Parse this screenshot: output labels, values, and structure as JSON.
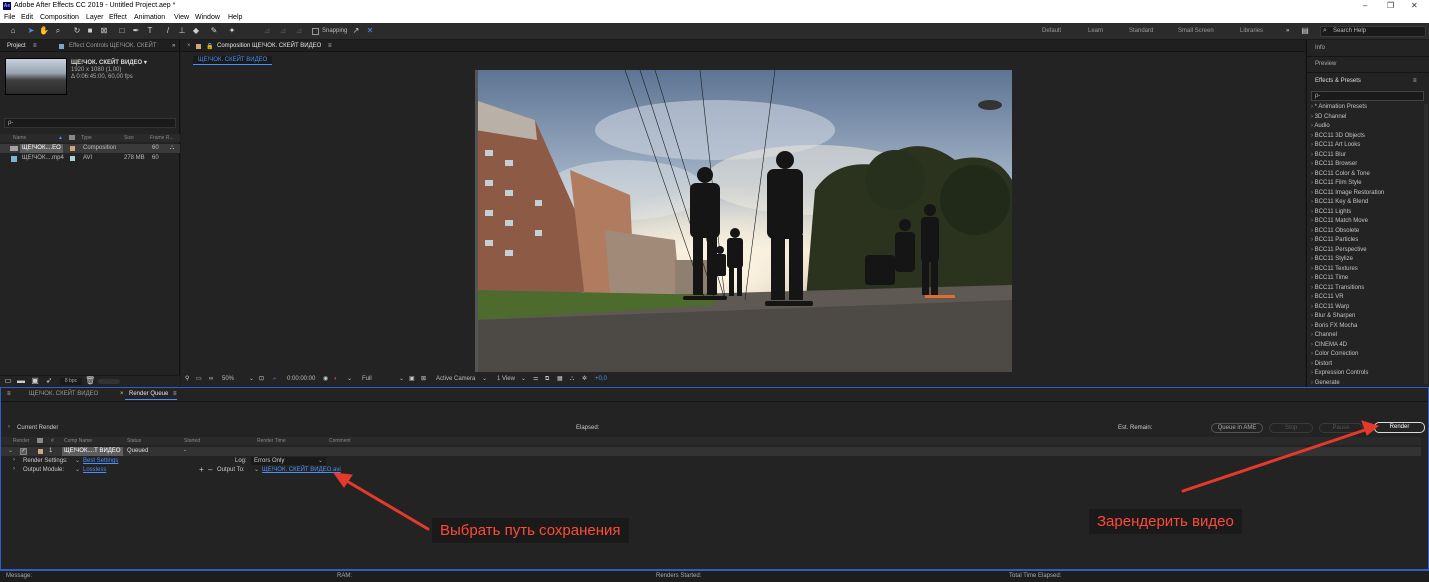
{
  "window": {
    "title": "Adobe After Effects CC 2019 - Untitled Project.aep *",
    "logo": "Ae",
    "controls": [
      "–",
      "❐",
      "✕"
    ]
  },
  "menu": [
    "File",
    "Edit",
    "Composition",
    "Layer",
    "Effect",
    "Animation",
    "View",
    "Window",
    "Help"
  ],
  "toolbar": {
    "snapping": "Snapping",
    "workspaces": [
      "Default",
      "Learn",
      "Standard",
      "Small Screen",
      "Libraries"
    ],
    "search_help": "Search Help",
    "more": "»"
  },
  "project": {
    "tab": "Project",
    "tab2": "Effect Controls ЩЕ!ЧОК. СКЕЙТ",
    "comp_name": "ЩЕ!ЧОК. СКЕЙТ ВИДЕО ▾",
    "comp_dims": "1920 x 1080 (1,00)",
    "comp_dur": "Δ 0:06:45:00, 60,00 fps",
    "search_placeholder": "ρ-",
    "columns": [
      "Name",
      "Type",
      "Size",
      "Frame R..."
    ],
    "rows": [
      {
        "name": "ЩЕ!ЧОК....EO",
        "type": "Composition",
        "size": "",
        "rate": "60"
      },
      {
        "name": "ЩЕ!ЧОК....mp4",
        "type": "AVI",
        "size": "278 MB",
        "rate": "60"
      }
    ],
    "bpc": "8 bpc"
  },
  "composition": {
    "tab": "Composition ЩЕ!ЧОК. СКЕЙТ ВИДЕО",
    "breadcrumb": "ЩЕ!ЧОК. СКЕЙТ ВИДЕО",
    "footer": {
      "zoom": "50%",
      "timecode": "0:00:00:00",
      "resolution": "Full",
      "camera": "Active Camera",
      "view": "1 View",
      "exposure": "+0,0"
    }
  },
  "right_panel": {
    "info": "Info",
    "preview": "Preview",
    "effects": "Effects & Presets",
    "search_placeholder": "ρ-",
    "items": [
      "* Animation Presets",
      "3D Channel",
      "Audio",
      "BCC11 3D Objects",
      "BCC11 Art Looks",
      "BCC11 Blur",
      "BCC11 Browser",
      "BCC11 Color & Tone",
      "BCC11 Film Style",
      "BCC11 Image Restoration",
      "BCC11 Key & Blend",
      "BCC11 Lights",
      "BCC11 Match Move",
      "BCC11 Obsolete",
      "BCC11 Particles",
      "BCC11 Perspective",
      "BCC11 Stylize",
      "BCC11 Textures",
      "BCC11 Time",
      "BCC11 Transitions",
      "BCC11 VR",
      "BCC11 Warp",
      "Blur & Sharpen",
      "Boris FX Mocha",
      "Channel",
      "CINEMA 4D",
      "Color Correction",
      "Distort",
      "Expression Controls",
      "Generate"
    ]
  },
  "render_queue": {
    "tab1": "ЩЕ!ЧОК. СКЕЙТ ВИДЕО",
    "tab2": "Render Queue",
    "current_render": "Current Render",
    "elapsed": "Elapsed:",
    "est_remain": "Est. Remain:",
    "buttons": {
      "queue_ame": "Queue in AME",
      "stop": "Stop",
      "pause": "Pause",
      "render": "Render"
    },
    "columns": [
      "Render",
      "#",
      "Comp Name",
      "Status",
      "Started",
      "Render Time",
      "Comment"
    ],
    "item": {
      "num": "1",
      "name": "ЩЕ!ЧОК....Т ВИДЕО",
      "status": "Queued",
      "started": "-"
    },
    "render_settings_label": "Render Settings:",
    "render_settings_value": "Best Settings",
    "log_label": "Log:",
    "log_value": "Errors Only",
    "output_module_label": "Output Module:",
    "output_module_value": "Lossless",
    "output_to_label": "Output To:",
    "output_to_value": "ЩЕ!ЧОК. СКЕЙТ ВИДЕО.avi"
  },
  "status": {
    "message": "Message:",
    "ram": "RAM:",
    "renders_started": "Renders Started:",
    "total_time": "Total Time Elapsed:"
  },
  "annotations": {
    "save_path": "Выбрать путь сохранения",
    "render_video": "Зарендерить видео"
  },
  "colors": {
    "accent": "#2f5fc5",
    "link": "#4b8ff7",
    "arrow": "#e53a2b"
  }
}
